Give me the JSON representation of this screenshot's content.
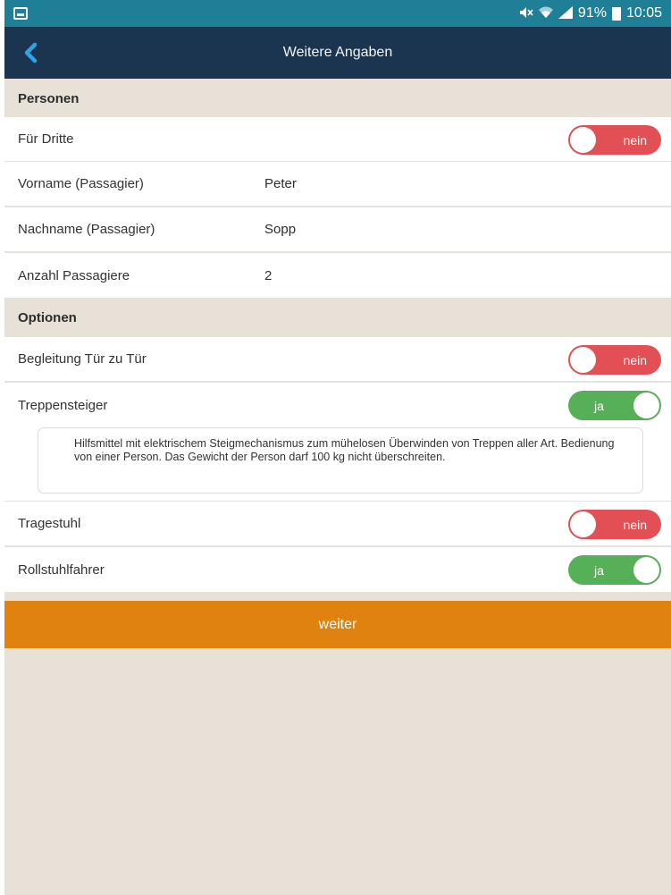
{
  "status_bar": {
    "battery_percent": "91%",
    "time": "10:05",
    "icons": [
      "notification-icon",
      "mute-icon",
      "wifi-icon",
      "signal-icon",
      "battery-icon"
    ]
  },
  "app_bar": {
    "title": "Weitere Angaben",
    "back_icon": "chevron-left-icon"
  },
  "sections": {
    "personen": {
      "title": "Personen",
      "fuer_dritte": {
        "label": "Für Dritte",
        "toggle": "nein",
        "on": false
      },
      "vorname": {
        "label": "Vorname (Passagier)",
        "value": "Peter"
      },
      "nachname": {
        "label": "Nachname (Passagier)",
        "value": "Sopp"
      },
      "anzahl": {
        "label": "Anzahl Passagiere",
        "value": "2"
      }
    },
    "optionen": {
      "title": "Optionen",
      "begleitung": {
        "label": "Begleitung Tür zu Tür",
        "toggle": "nein",
        "on": false
      },
      "treppensteiger": {
        "label": "Treppensteiger",
        "toggle": "ja",
        "on": true,
        "info": "Hilfsmittel mit elektrischem Steigmechanismus zum mühelosen Überwinden von Treppen aller Art. Bedienung von einer Person. Das Gewicht der Person darf 100 kg nicht überschreiten."
      },
      "tragestuhl": {
        "label": "Tragestuhl",
        "toggle": "nein",
        "on": false
      },
      "rollstuhlfahrer": {
        "label": "Rollstuhlfahrer",
        "toggle": "ja",
        "on": true
      }
    }
  },
  "submit_label": "weiter",
  "colors": {
    "status_bar": "#1f7f97",
    "app_bar": "#1b3550",
    "back_chevron": "#2fa3e6",
    "background": "#e7e1d7",
    "toggle_off": "#e25055",
    "toggle_on": "#56b057",
    "submit": "#df820f"
  }
}
